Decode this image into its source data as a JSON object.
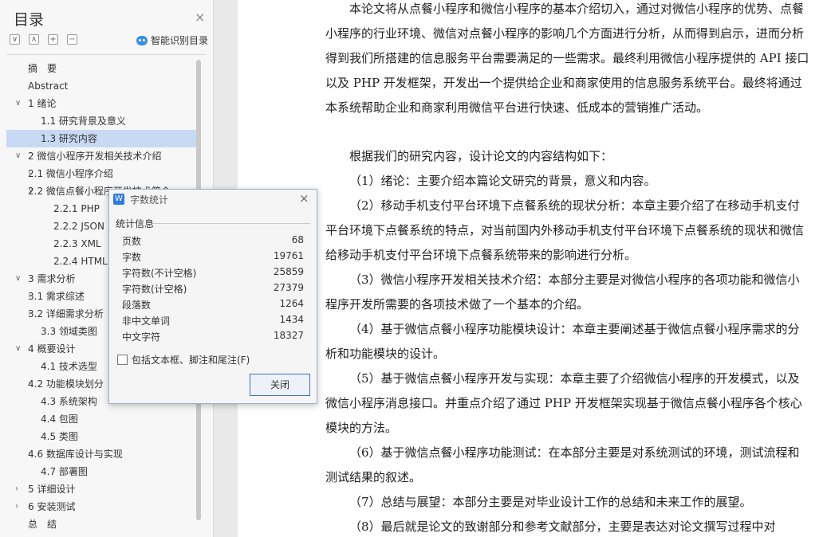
{
  "sidebar": {
    "title": "目录",
    "close_glyph": "×",
    "smart_toc_label": "智能识别目录",
    "toolbar_buttons": [
      "∨",
      "∧",
      "+",
      "−"
    ],
    "items": [
      {
        "label": "摘　要",
        "level": 1
      },
      {
        "label": "Abstract",
        "level": 1
      },
      {
        "label": "1 绪论",
        "level": 0,
        "arrow": "∨"
      },
      {
        "label": "1.1 研究背景及意义",
        "level": 2
      },
      {
        "label": "1.3 研究内容",
        "level": 2,
        "active": true
      },
      {
        "label": "2 微信小程序开发相关技术介绍",
        "level": 0,
        "arrow": "∨"
      },
      {
        "label": "2.1 微信小程序介绍",
        "level": 1,
        "arrow": "›"
      },
      {
        "label": "2.2 微信点餐小程序开发技术简介",
        "level": 1,
        "arrow": "∨"
      },
      {
        "label": "2.2.1 PHP",
        "level": 3
      },
      {
        "label": "2.2.2 JSON",
        "level": 3
      },
      {
        "label": "2.2.3 XML",
        "level": 3
      },
      {
        "label": "2.2.4 HTML",
        "level": 3
      },
      {
        "label": "3 需求分析",
        "level": 0,
        "arrow": "∨"
      },
      {
        "label": "3.1 需求综述",
        "level": 1,
        "arrow": "›"
      },
      {
        "label": "3.2  详细需求分析",
        "level": 1,
        "arrow": "›"
      },
      {
        "label": "3.3 领域类图",
        "level": 2
      },
      {
        "label": "4 概要设计",
        "level": 0,
        "arrow": "∨"
      },
      {
        "label": "4.1  技术选型",
        "level": 2
      },
      {
        "label": "4.2  功能模块划分",
        "level": 1,
        "arrow": "›"
      },
      {
        "label": "4.3  系统架构",
        "level": 2
      },
      {
        "label": "4.4  包图",
        "level": 2
      },
      {
        "label": "4.5  类图",
        "level": 2
      },
      {
        "label": "4.6  数据库设计与实现",
        "level": 1,
        "arrow": "›"
      },
      {
        "label": "4.7  部署图",
        "level": 2
      },
      {
        "label": "5 详细设计",
        "level": 0,
        "arrow": "›"
      },
      {
        "label": "6 安装测试",
        "level": 0,
        "arrow": "›"
      },
      {
        "label": "总　结",
        "level": 1
      }
    ]
  },
  "document": {
    "paragraphs": [
      "本论文将从点餐小程序和微信小程序的基本介绍切入，通过对微信小程序的优势、点餐小程序的行业环境、微信对点餐小程序的影响几个方面进行分析，从而得到启示，进而分析得到我们所搭建的信息服务平台需要满足的一些需求。最终利用微信小程序提供的 API 接口以及  PHP 开发框架，开发出一个提供给企业和商家使用的信息服务系统平台。最终将通过本系统帮助企业和商家利用微信平台进行快速、低成本的营销推广活动。",
      "根据我们的研究内容，设计论文的内容结构如下：",
      "（1）绪论：主要介绍本篇论文研究的背景，意义和内容。",
      "（2）移动手机支付平台环境下点餐系统的现状分析：本章主要介绍了在移动手机支付平台环境下点餐系统的特点，对当前国内外移动手机支付平台环境下点餐系统的现状和微信给移动手机支付平台环境下点餐系统带来的影响进行分析。",
      "（3）微信小程序开发相关技术介绍：本部分主要是对微信小程序的各项功能和微信小程序开发所需要的各项技术做了一个基本的介绍。",
      "（4）基于微信点餐小程序功能模块设计：本章主要阐述基于微信点餐小程序需求的分析和功能模块的设计。",
      "（5）基于微信点餐小程序开发与实现：本章主要了介绍微信小程序的开发模式，以及微信小程序消息接口。并重点介绍了通过 PHP 开发框架实现基于微信点餐小程序各个核心模块的方法。",
      "（6）基于微信点餐小程序功能测试：在本部分主要是对系统测试的环境，测试流程和测试结果的叙述。",
      "（7）总结与展望：本部分主要是对毕业设计工作的总结和未来工作的展望。",
      "（8）最后就是论文的致谢部分和参考文献部分，主要是表达对论文撰写过程中对"
    ]
  },
  "dialog": {
    "logo": "W",
    "title": "字数统计",
    "close_glyph": "×",
    "section_heading": "统计信息",
    "stats": [
      {
        "label": "页数",
        "value": "68"
      },
      {
        "label": "字数",
        "value": "19761"
      },
      {
        "label": "字符数(不计空格)",
        "value": "25859"
      },
      {
        "label": "字符数(计空格)",
        "value": "27379"
      },
      {
        "label": "段落数",
        "value": "1264"
      },
      {
        "label": "非中文单词",
        "value": "1434"
      },
      {
        "label": "中文字符",
        "value": "18327"
      }
    ],
    "include_label": "包括文本框、脚注和尾注(F)",
    "include_checked": false,
    "close_button_label": "关闭"
  },
  "colors": {
    "active_item_bg": "#c8daf3",
    "dialog_button_border": "#3b74c7",
    "logo_blue": "#2f7be0"
  }
}
